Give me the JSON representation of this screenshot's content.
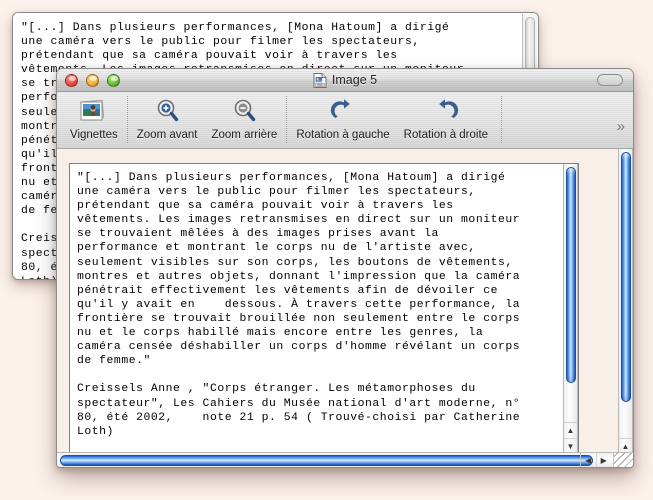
{
  "desktop": {
    "background_color": "#fdf1eb"
  },
  "background_window": {
    "name": "background-document-window",
    "body_text": "\"[...] Dans plusieurs performances, [Mona Hatoum] a dirigé\nune caméra vers le public pour filmer les spectateurs,\nprétendant que sa caméra pouvait voir à travers les\nvêtements. Les images retransmises en direct sur un moniteur\nse trouvaient mêlées à des images prises avant la\nperformance et montrant le corps nu de l'artiste avec,\nseulement visibles sur son corps, les boutons de vêtements,\nmontres et autres objets, donnant l'impression que la caméra\npénétrait effectivement les vêtements afin de dévoiler ce\nqu'il y avait en    dessous. À travers cette performance, la\nfrontière se trouvait brouillée non seulement entre le corps\nnu et le corps habillé mais encore entre les genres, la\ncaméra censée déshabiller un corps d'homme révélant un corps\nde femme.\"\n\nCreissels Anne , \"Corps étranger. Les métamorphoses du\nspectateur\", Les Cahiers du Musée national d'art moderne, n°\n80, été 2002,    note 21 p. 54 ( Trouvé-choisi par Catherine\nLoth)"
  },
  "front_window": {
    "title": "Image 5",
    "title_icon": "pdf-document-icon",
    "traffic_lights": {
      "close": "close-button",
      "minimize": "minimize-button",
      "zoom": "zoom-button",
      "close_color": "#e8483c",
      "minimize_color": "#f0a92c",
      "zoom_color": "#5fbe2e"
    },
    "toolbar_toggle": "toolbar-toggle-pill",
    "toolbar": {
      "overflow_label": "»",
      "items": [
        {
          "label": "Vignettes",
          "icon": "thumbnails-icon"
        },
        {
          "label": "Zoom avant",
          "icon": "zoom-in-icon"
        },
        {
          "label": "Zoom arrière",
          "icon": "zoom-out-icon"
        },
        {
          "label": "Rotation à gauche",
          "icon": "rotate-left-icon"
        },
        {
          "label": "Rotation à droite",
          "icon": "rotate-right-icon"
        }
      ]
    },
    "document_text": "\"[...] Dans plusieurs performances, [Mona Hatoum] a dirigé\nune caméra vers le public pour filmer les spectateurs,\nprétendant que sa caméra pouvait voir à travers les\nvêtements. Les images retransmises en direct sur un moniteur\nse trouvaient mêlées à des images prises avant la\nperformance et montrant le corps nu de l'artiste avec,\nseulement visibles sur son corps, les boutons de vêtements,\nmontres et autres objets, donnant l'impression que la caméra\npénétrait effectivement les vêtements afin de dévoiler ce\nqu'il y avait en    dessous. À travers cette performance, la\nfrontière se trouvait brouillée non seulement entre le corps\nnu et le corps habillé mais encore entre les genres, la\ncaméra censée déshabiller un corps d'homme révélant un corps\nde femme.\"\n\nCreissels Anne , \"Corps étranger. Les métamorphoses du\nspectateur\", Les Cahiers du Musée national d'art moderne, n°\n80, été 2002,    note 21 p. 54 ( Trouvé-choisi par Catherine\nLoth)",
    "scrollbars": {
      "accent_color": "#3f86e0",
      "up_arrow": "▲",
      "down_arrow": "▼",
      "left_arrow": "◀",
      "right_arrow": "▶"
    },
    "resize_grip": "resize-grip"
  }
}
